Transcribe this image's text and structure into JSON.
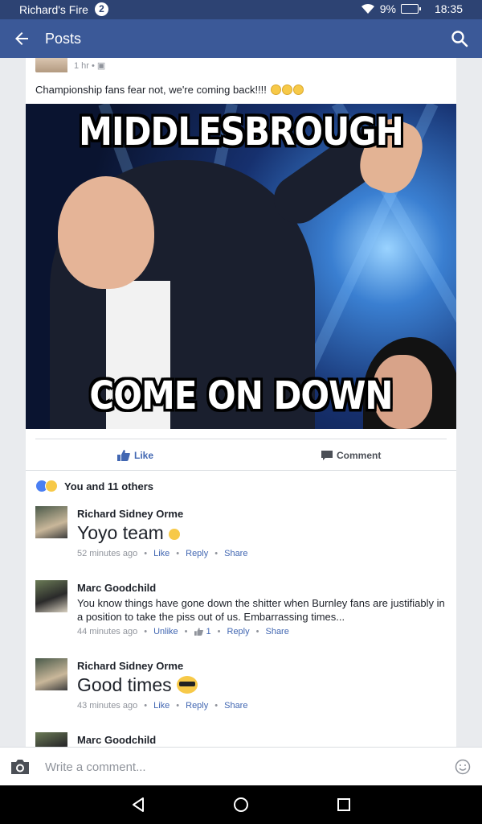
{
  "status_bar": {
    "app_name": "Richard's Fire",
    "notification_count": "2",
    "battery": "9%",
    "time": "18:35",
    "icons": [
      "wifi-icon",
      "battery-icon"
    ]
  },
  "app_bar": {
    "title": "Posts",
    "icons": [
      "back-arrow-icon",
      "search-icon"
    ]
  },
  "post": {
    "time": "1 hr",
    "text": "Championship fans fear not, we're coming back!!!!",
    "meme_top_text": "MIDDLESBROUGH",
    "meme_bottom_text": "COME ON DOWN"
  },
  "actions": {
    "like_label": "Like",
    "comment_label": "Comment"
  },
  "reactions": {
    "summary": "You and 11 others"
  },
  "comments": [
    {
      "author": "Richard Sidney Orme",
      "text": "Yoyo team",
      "time": "52 minutes ago",
      "like_label": "Like",
      "reply_label": "Reply",
      "share_label": "Share"
    },
    {
      "author": "Marc Goodchild",
      "text": "You know things have gone down the shitter when Burnley fans are justifiably in a position to take the piss out of us. Embarrassing times...",
      "time": "44 minutes ago",
      "like_label": "Unlike",
      "like_count": "1",
      "reply_label": "Reply",
      "share_label": "Share"
    },
    {
      "author": "Richard Sidney Orme",
      "text": "Good times",
      "time": "43 minutes ago",
      "like_label": "Like",
      "reply_label": "Reply",
      "share_label": "Share"
    },
    {
      "author": "Marc Goodchild"
    }
  ],
  "composer": {
    "placeholder": "Write a comment..."
  },
  "colors": {
    "status_bar": "#2d4373",
    "app_bar": "#3b5998",
    "link": "#4267b2",
    "background": "#e9ebee"
  }
}
